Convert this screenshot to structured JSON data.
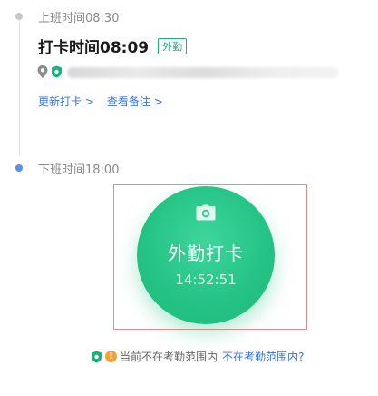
{
  "on_duty": {
    "label": "上班时间08:30",
    "punch_title": "打卡时间08:09",
    "badge": "外勤",
    "update_link": "更新打卡 >",
    "notes_link": "查看备注 >"
  },
  "off_duty": {
    "label": "下班时间18:00"
  },
  "punch_button": {
    "label": "外勤打卡",
    "time": "14:52:51"
  },
  "notice": {
    "text": "当前不在考勤范围内",
    "link": "不在考勤范围内?"
  },
  "colors": {
    "accent_green": "#24c485",
    "link_blue": "#3a73d8",
    "warning_orange": "#f2a23a"
  }
}
